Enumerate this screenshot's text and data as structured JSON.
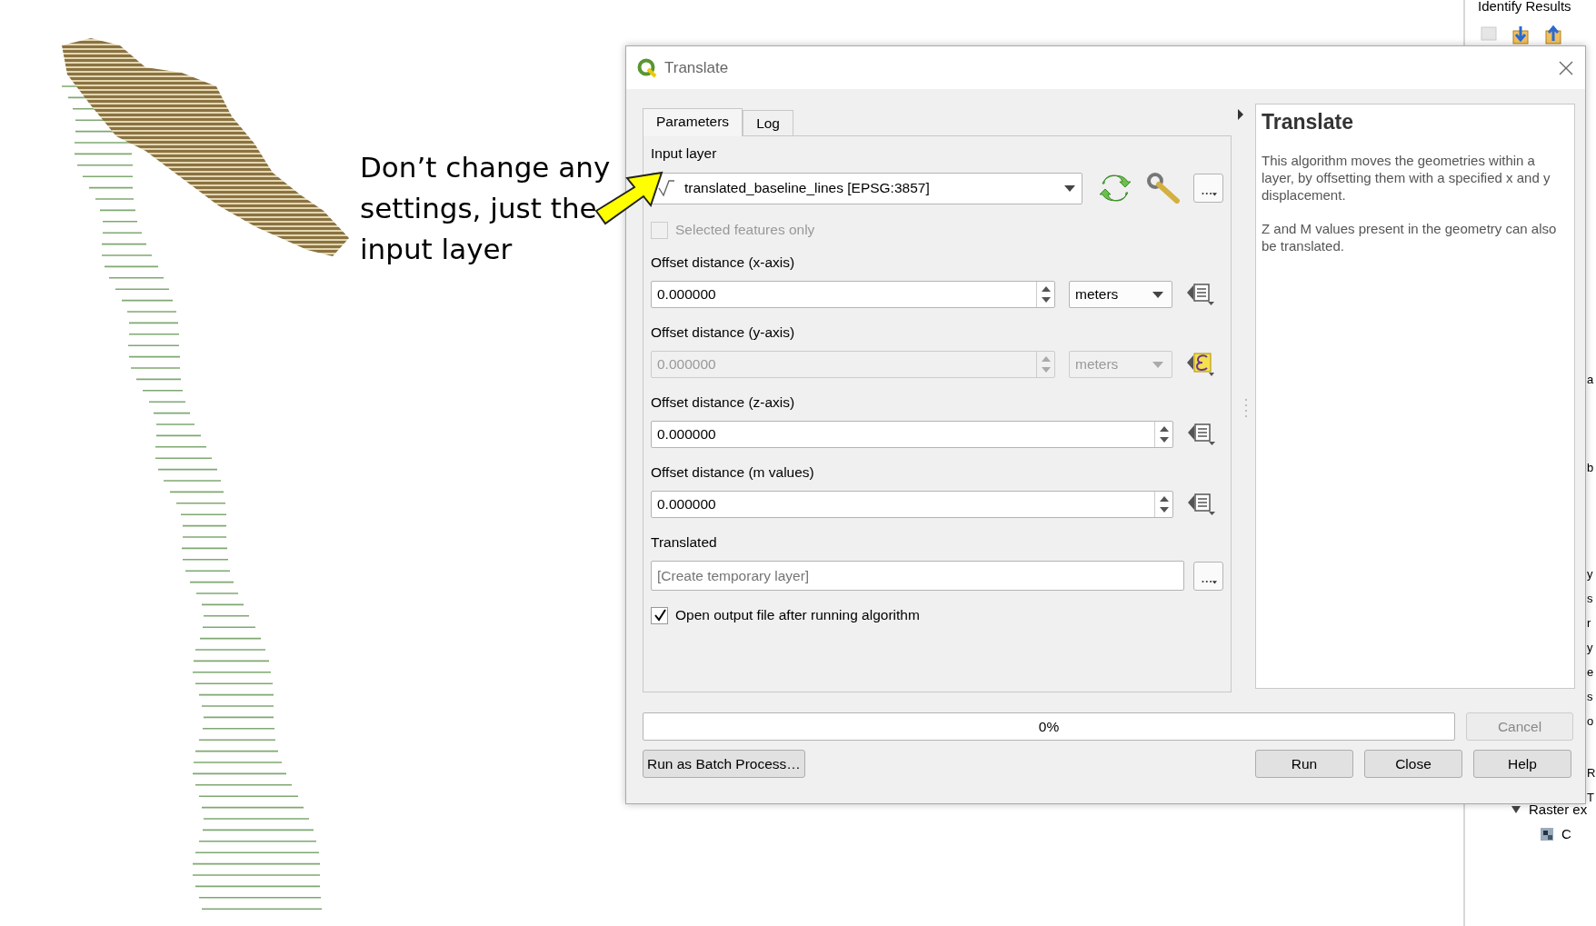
{
  "canvas": {
    "annotation": "Don’t change any settings, just the input layer"
  },
  "side_panel": {
    "title": "Identify Results",
    "edge_fragments": [
      "a",
      "b",
      "y",
      "s",
      "r",
      "y",
      "e",
      "s",
      "o",
      "R",
      "T"
    ],
    "tree": [
      {
        "label": "Raster ex",
        "expanded": true,
        "children": [
          {
            "label": "C"
          }
        ]
      }
    ]
  },
  "dialog": {
    "title": "Translate",
    "tabs": [
      {
        "label": "Parameters",
        "selected": true
      },
      {
        "label": "Log",
        "selected": false
      }
    ],
    "parameters": [
      {
        "kind": "layer",
        "label": "Input layer",
        "value": "translated_baseline_lines [EPSG:3857]"
      },
      {
        "kind": "checkbox",
        "label": "Selected features only",
        "checked": false,
        "disabled": true
      },
      {
        "kind": "number",
        "label": "Offset distance (x-axis)",
        "value": "0.000000",
        "unit": "meters",
        "disabled": false,
        "expression_active": false
      },
      {
        "kind": "number",
        "label": "Offset distance (y-axis)",
        "value": "0.000000",
        "unit": "meters",
        "disabled": true,
        "expression_active": true
      },
      {
        "kind": "number",
        "label": "Offset distance (z-axis)",
        "value": "0.000000",
        "disabled": false,
        "expression_active": false
      },
      {
        "kind": "number",
        "label": "Offset distance (m values)",
        "value": "0.000000",
        "disabled": false,
        "expression_active": false
      },
      {
        "kind": "output",
        "label": "Translated",
        "placeholder": "[Create temporary layer]"
      },
      {
        "kind": "checkbox",
        "label": "Open output file after running algorithm",
        "checked": true,
        "disabled": false
      }
    ],
    "help": {
      "title": "Translate",
      "paragraphs": [
        "This algorithm moves the geometries within a layer, by offsetting them with a specified x and y displacement.",
        "Z and M values present in the geometry can also be translated."
      ]
    },
    "progress": {
      "level": 0,
      "reading": "0%"
    },
    "cancel": {
      "label": "Cancel",
      "disabled": true
    },
    "batch_button": "Run as Batch Process…",
    "buttons": [
      "Run",
      "Close",
      "Help"
    ]
  }
}
